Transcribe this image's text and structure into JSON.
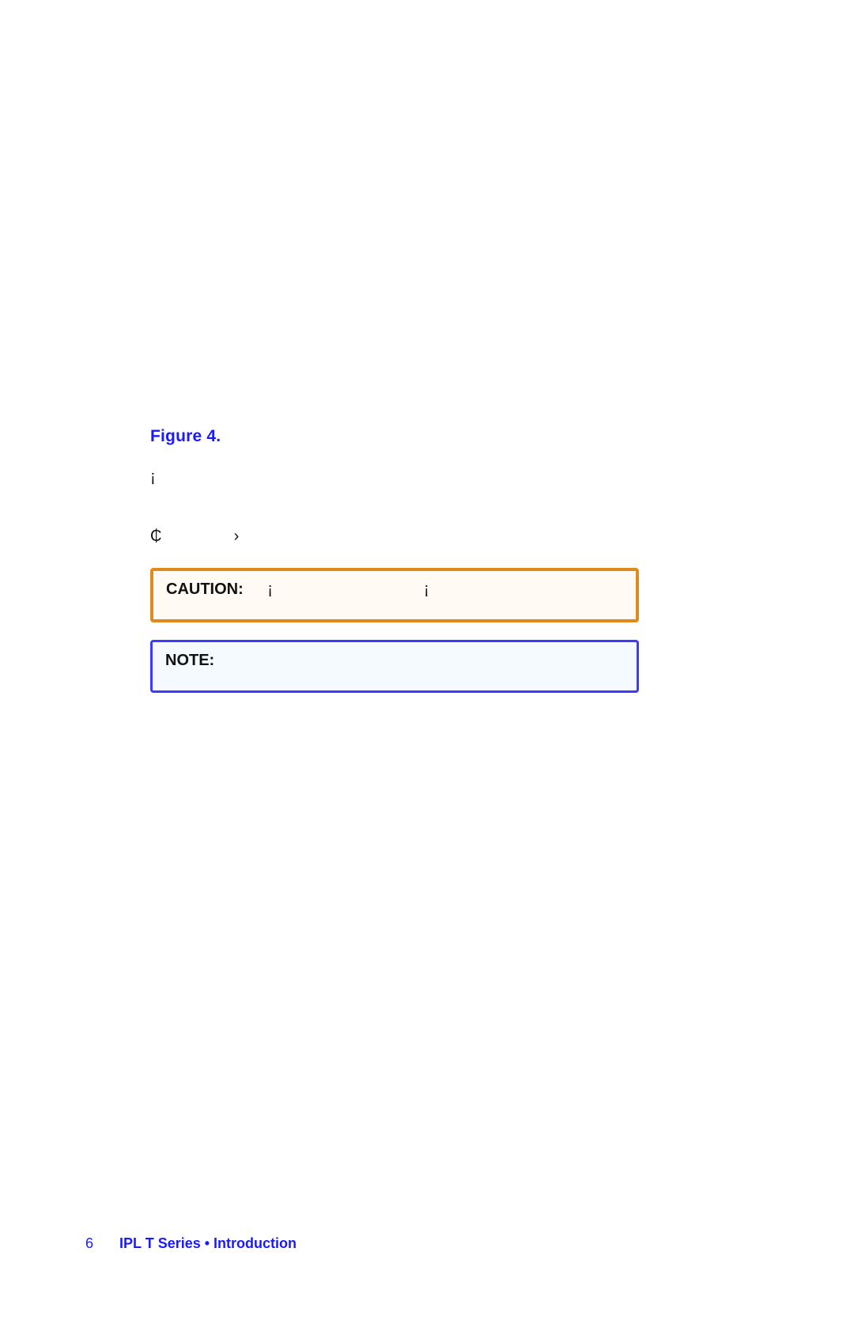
{
  "figure": {
    "label": "Figure 4."
  },
  "line1": {
    "symbol": "¡"
  },
  "line2": {
    "symbol1": "₵",
    "symbol2": "›"
  },
  "caution": {
    "label": "CAUTION:",
    "sym1": "¡",
    "sym2": "¡"
  },
  "note": {
    "label": "NOTE:"
  },
  "footer": {
    "page": "6",
    "title": "IPL T Series • Introduction"
  }
}
